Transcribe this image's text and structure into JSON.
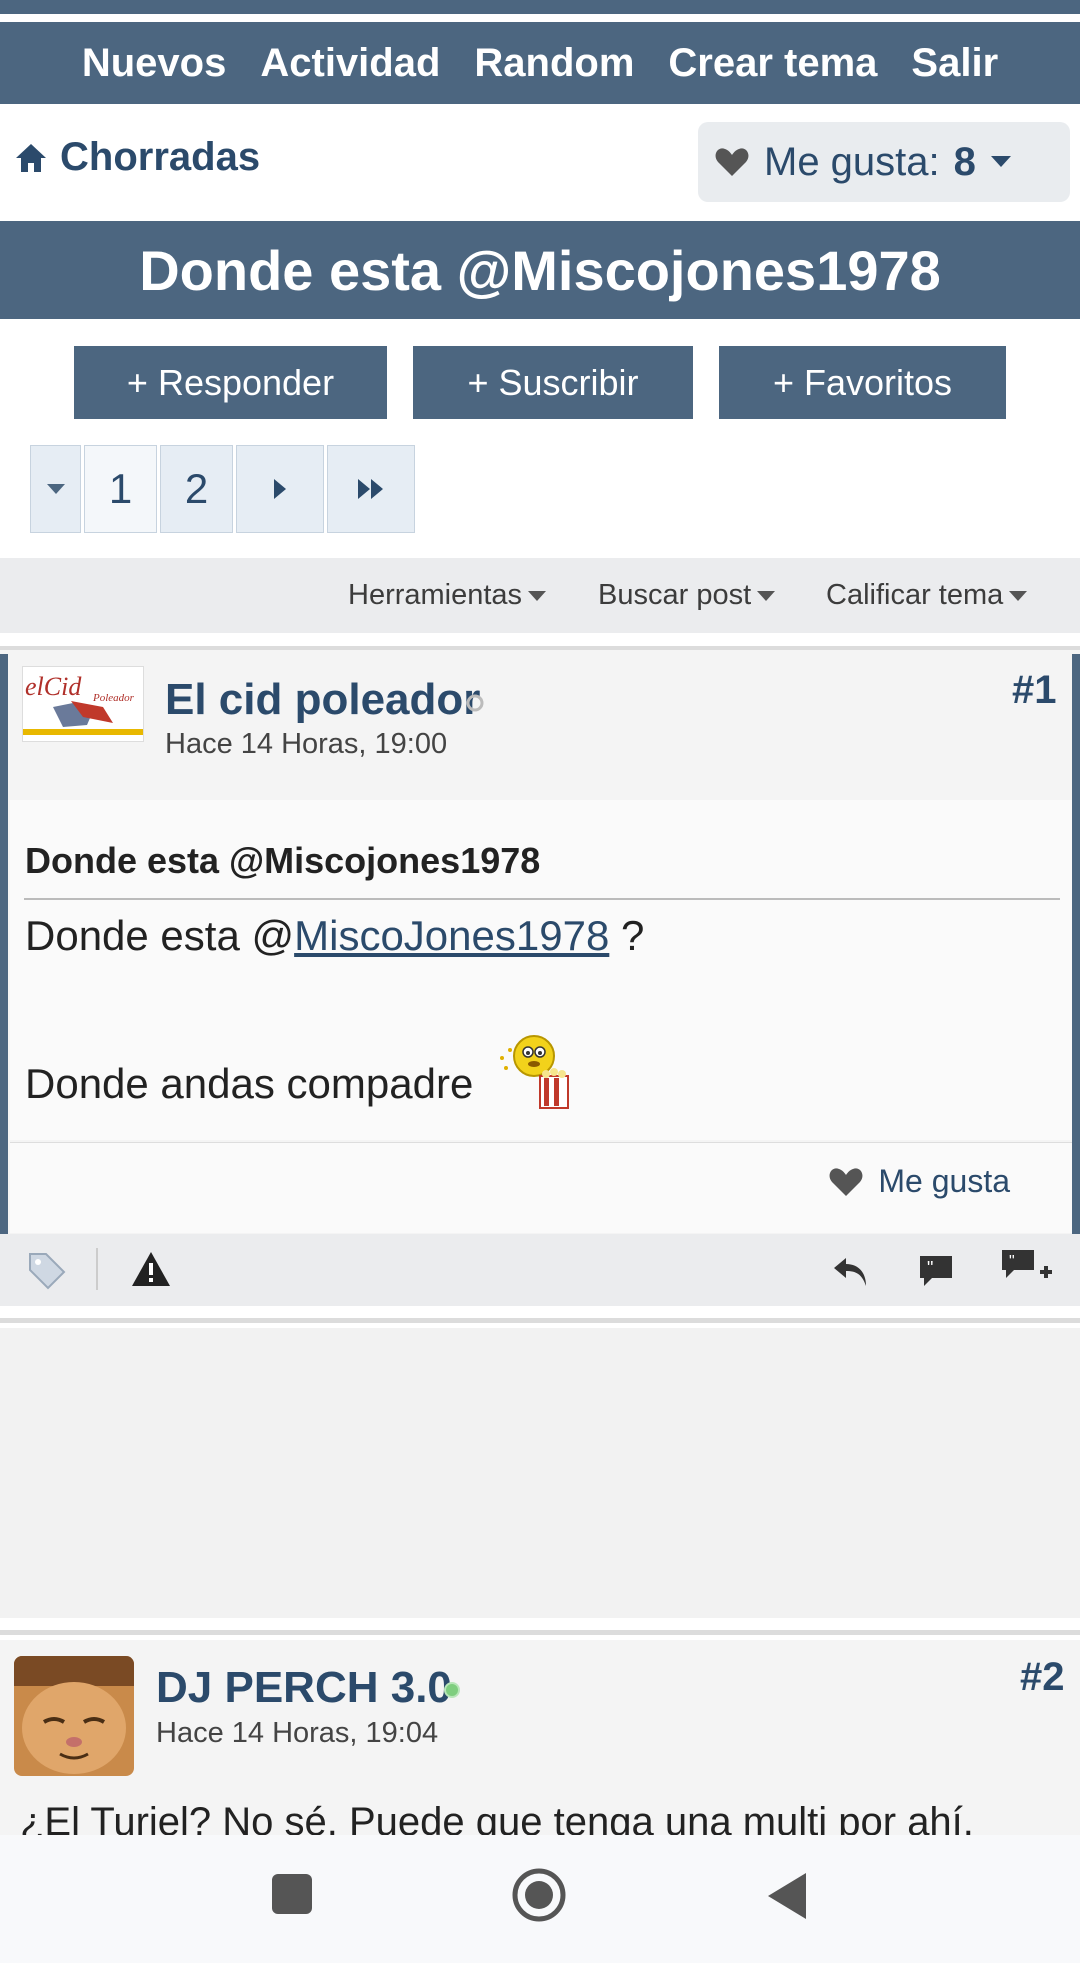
{
  "nav": {
    "items": [
      "Nuevos",
      "Actividad",
      "Random",
      "Crear tema",
      "Salir"
    ]
  },
  "breadcrumb": {
    "label": "Chorradas"
  },
  "likes": {
    "label": "Me gusta:",
    "count": "8"
  },
  "thread": {
    "title": "Donde esta @Miscojones1978"
  },
  "actions": {
    "reply": "+ Responder",
    "subscribe": "+ Suscribir",
    "favorites": "+ Favoritos"
  },
  "pager": {
    "pages": [
      "1",
      "2"
    ],
    "current": "1"
  },
  "tools": {
    "tools": "Herramientas",
    "search": "Buscar post",
    "rate": "Calificar tema"
  },
  "post1": {
    "author": "El cid poleador",
    "time": "Hace 14 Horas, 19:00",
    "number": "#1",
    "title": "Donde esta @Miscojones1978",
    "line1_prefix": "Donde esta @",
    "line1_link": "MiscoJones1978",
    "line1_suffix": " ?",
    "line2": "Donde andas compadre",
    "like_label": "Me gusta",
    "avatar_text": "elCid",
    "avatar_sub": "Poleador"
  },
  "post2": {
    "author": "DJ PERCH 3.0",
    "time": "Hace 14 Horas, 19:04",
    "number": "#2",
    "text": "¿El Turiel? No sé. Puede que tenga una multi por ahí."
  },
  "colors": {
    "primary": "#4c6680",
    "link": "#2b4a6b",
    "online": "#7fce7f",
    "offline": "#bbbbbb"
  }
}
